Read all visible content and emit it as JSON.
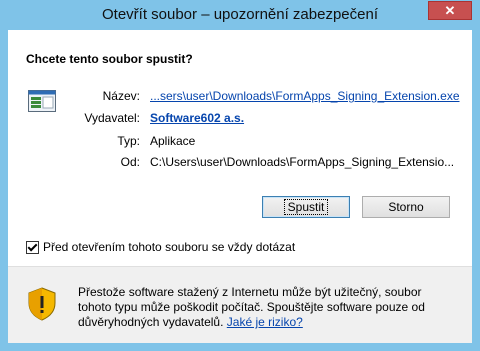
{
  "window": {
    "title": "Otevřít soubor – upozornění zabezpečení",
    "close_glyph": "✕"
  },
  "question": "Chcete tento soubor spustit?",
  "fields": {
    "name_label": "Název:",
    "name_value": "...sers\\user\\Downloads\\FormApps_Signing_Extension.exe",
    "publisher_label": "Vydavatel:",
    "publisher_value": "Software602 a.s.",
    "type_label": "Typ:",
    "type_value": "Aplikace",
    "from_label": "Od:",
    "from_value": "C:\\Users\\user\\Downloads\\FormApps_Signing_Extensio..."
  },
  "buttons": {
    "run": "Spustit",
    "cancel": "Storno"
  },
  "checkbox": {
    "label": "Před otevřením tohoto souboru se vždy dotázat",
    "checked": true
  },
  "warning": {
    "text": "Přestože software stažený z Internetu může být užitečný, soubor tohoto typu může poškodit počítač. Spouštějte software pouze od důvěryhodných vydavatelů.",
    "link": "Jaké je riziko?"
  },
  "colors": {
    "frame": "#7fc3e8",
    "close": "#c75050",
    "link": "#0645ad",
    "footer": "#f0f0f0"
  },
  "icons": {
    "file": "exe-file-icon",
    "shield": "security-shield-icon"
  }
}
